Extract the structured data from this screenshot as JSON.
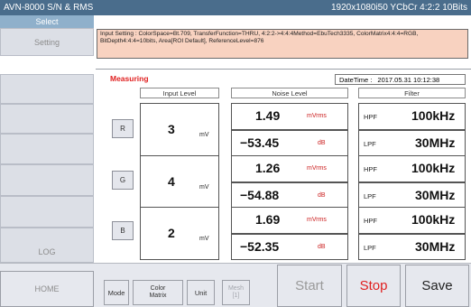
{
  "title_bar": {
    "app_name": "AVN-8000  S/N & RMS",
    "format": "1920x1080i50   YCbCr 4:2:2 10Bits"
  },
  "sidebar": {
    "select_label": "Select",
    "setting_label": "Setting",
    "log_label": "LOG",
    "home_label": "HOME"
  },
  "info": {
    "line1": "Input Setting :  ColorSpace=Bt.709, TransferFunction=THRU, 4:2:2->4:4:4Method=EbuTech3335, ColorMatrix4:4:4=RGB,",
    "line2": "BitDepth4:4:4=10bits, Area[ROI Default], ReferenceLevel=876"
  },
  "status": {
    "measuring": "Measuring",
    "datetime_label": "DateTime :",
    "datetime_value": "2017.05.31  10:12:38"
  },
  "headers": {
    "input_level": "Input Level",
    "noise_level": "Noise Level",
    "filter": "Filter"
  },
  "channels": [
    {
      "name": "R",
      "input_value": "3",
      "input_unit": "mV",
      "noise_rms": "1.49",
      "noise_rms_unit": "mVrms",
      "noise_db": "−53.45",
      "noise_db_unit": "dB",
      "hpf_label": "HPF",
      "hpf_value": "100kHz",
      "lpf_label": "LPF",
      "lpf_value": "30MHz"
    },
    {
      "name": "G",
      "input_value": "4",
      "input_unit": "mV",
      "noise_rms": "1.26",
      "noise_rms_unit": "mVrms",
      "noise_db": "−54.88",
      "noise_db_unit": "dB",
      "hpf_label": "HPF",
      "hpf_value": "100kHz",
      "lpf_label": "LPF",
      "lpf_value": "30MHz"
    },
    {
      "name": "B",
      "input_value": "2",
      "input_unit": "mV",
      "noise_rms": "1.69",
      "noise_rms_unit": "mVrms",
      "noise_db": "−52.35",
      "noise_db_unit": "dB",
      "hpf_label": "HPF",
      "hpf_value": "100kHz",
      "lpf_label": "LPF",
      "lpf_value": "30MHz"
    }
  ],
  "toolbar": {
    "mode_label": "Mode",
    "color_matrix_line1": "Color",
    "color_matrix_line2": "Matrix",
    "unit_label": "Unit",
    "mesh_line1": "Mesh",
    "mesh_line2": "[1]",
    "start_label": "Start",
    "stop_label": "Stop",
    "save_label": "Save"
  },
  "colors": {
    "title_bar": "#4a6d8c",
    "select_tab": "#8fb0cb",
    "info_bg": "#f8d2c0",
    "measuring_red": "#e02020",
    "stop_red": "#e02020"
  }
}
